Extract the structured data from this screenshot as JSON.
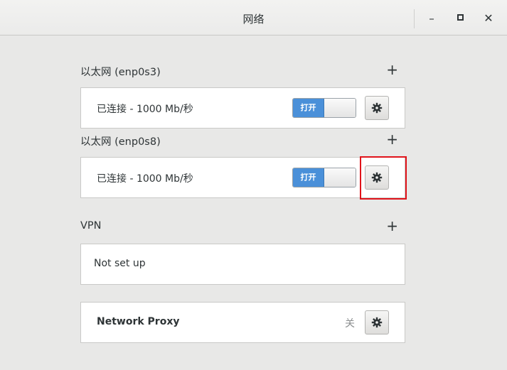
{
  "window": {
    "title": "网络",
    "controls": {
      "minimize": "–",
      "maximize": "▫",
      "close": "✕"
    }
  },
  "sections": [
    {
      "title": "以太网 (enp0s3)",
      "add_label": "+",
      "status": "已连接 - 1000 Mb/秒",
      "toggle_label": "打开",
      "toggle_state": "on",
      "settings_icon": "gear-icon"
    },
    {
      "title": "以太网 (enp0s8)",
      "add_label": "+",
      "status": "已连接 - 1000 Mb/秒",
      "toggle_label": "打开",
      "toggle_state": "on",
      "settings_icon": "gear-icon",
      "highlighted": true
    }
  ],
  "vpn": {
    "title": "VPN",
    "add_label": "+",
    "status": "Not set up"
  },
  "proxy": {
    "label": "Network Proxy",
    "state": "关",
    "settings_icon": "gear-icon"
  },
  "colors": {
    "toggle_on": "#4a90d9",
    "highlight": "#e0131a",
    "background": "#e8e8e7"
  }
}
